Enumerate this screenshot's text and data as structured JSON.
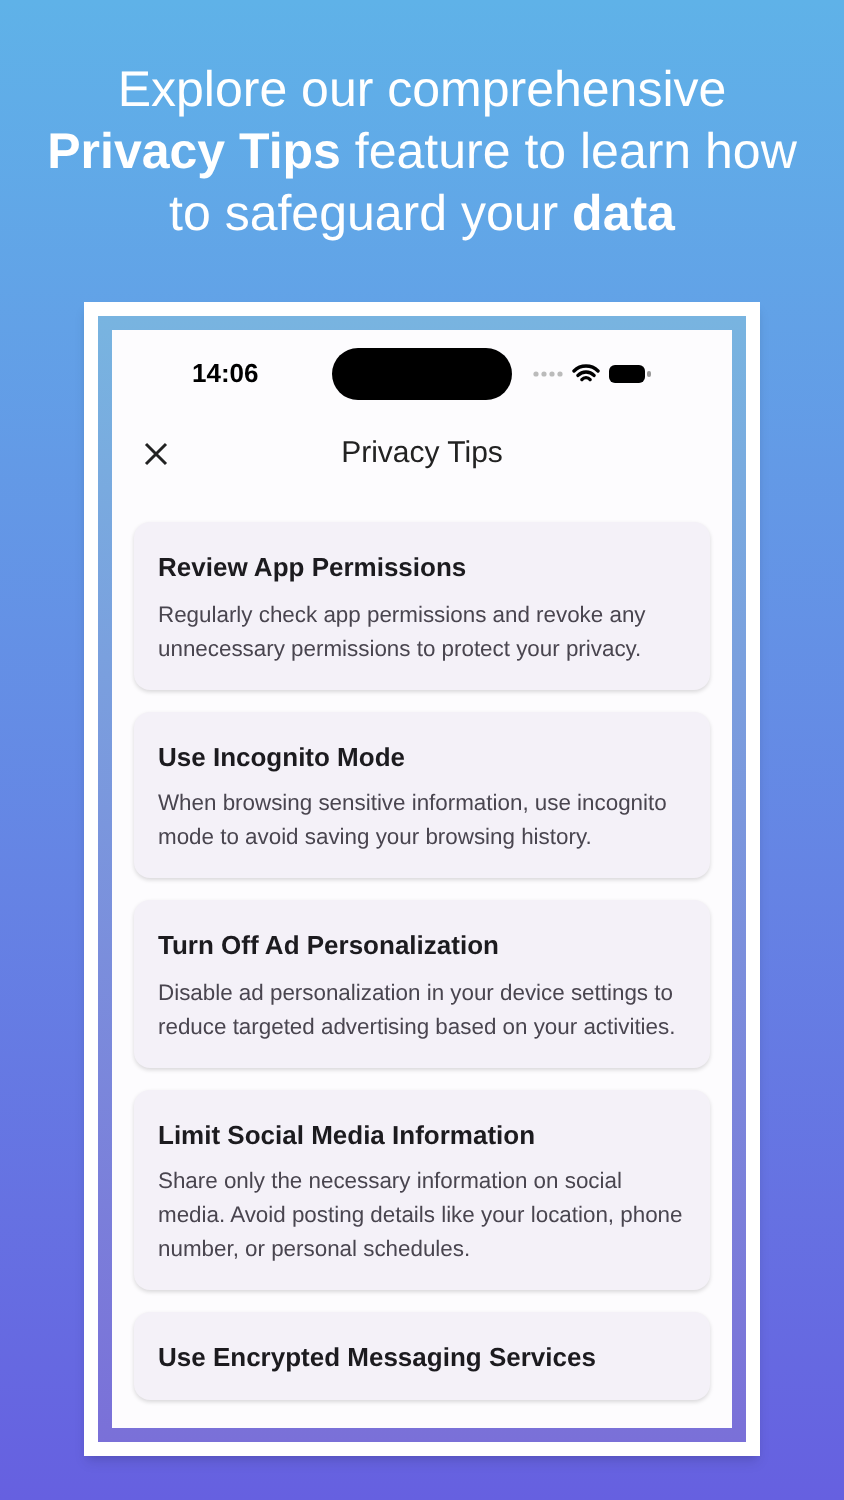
{
  "headline": "Explore our comprehensive **Privacy Tips** feature to learn how to safeguard your **data**",
  "status_bar": {
    "time": "14:06"
  },
  "nav": {
    "title": "Privacy Tips"
  },
  "tips": [
    {
      "title": "Review App Permissions",
      "body": "Regularly check app permissions and revoke any unnecessary permissions to protect your privacy."
    },
    {
      "title": "Use Incognito Mode",
      "body": "When browsing sensitive information, use incognito mode to avoid saving your browsing history."
    },
    {
      "title": "Turn Off Ad Personalization",
      "body": "Disable ad personalization in your device settings to reduce targeted advertising based on your activities."
    },
    {
      "title": "Limit Social Media Information",
      "body": "Share only the necessary information on social media. Avoid posting details like your location, phone number, or personal schedules."
    },
    {
      "title": "Use Encrypted Messaging Services"
    }
  ]
}
